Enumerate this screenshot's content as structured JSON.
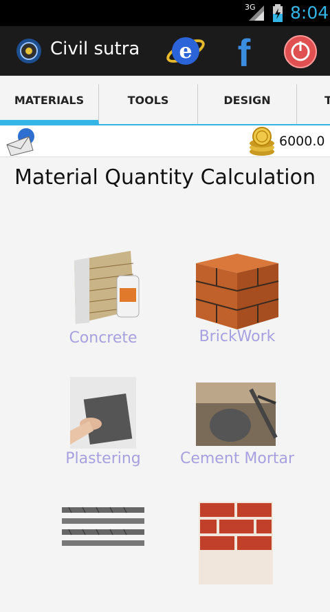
{
  "status": {
    "network": "3G",
    "time": "8:04"
  },
  "header": {
    "app_title": "Civil sutra",
    "icons": [
      "app-logo-icon",
      "internet-explorer-icon",
      "facebook-icon",
      "power-icon"
    ]
  },
  "tabs": [
    {
      "label": "MATERIALS",
      "active": true
    },
    {
      "label": "TOOLS",
      "active": false
    },
    {
      "label": "DESIGN",
      "active": false
    },
    {
      "label": "T",
      "active": false
    }
  ],
  "toolbar": {
    "coins": "6000.0"
  },
  "main": {
    "title": "Material Quantity Calculation",
    "items": [
      {
        "label": "Concrete"
      },
      {
        "label": "BrickWork"
      },
      {
        "label": "Plastering"
      },
      {
        "label": "Cement Mortar"
      },
      {
        "label": ""
      },
      {
        "label": ""
      }
    ]
  },
  "colors": {
    "accent": "#33b5e5",
    "label": "#a7a0e0",
    "action_bar": "#1b1b1b"
  }
}
